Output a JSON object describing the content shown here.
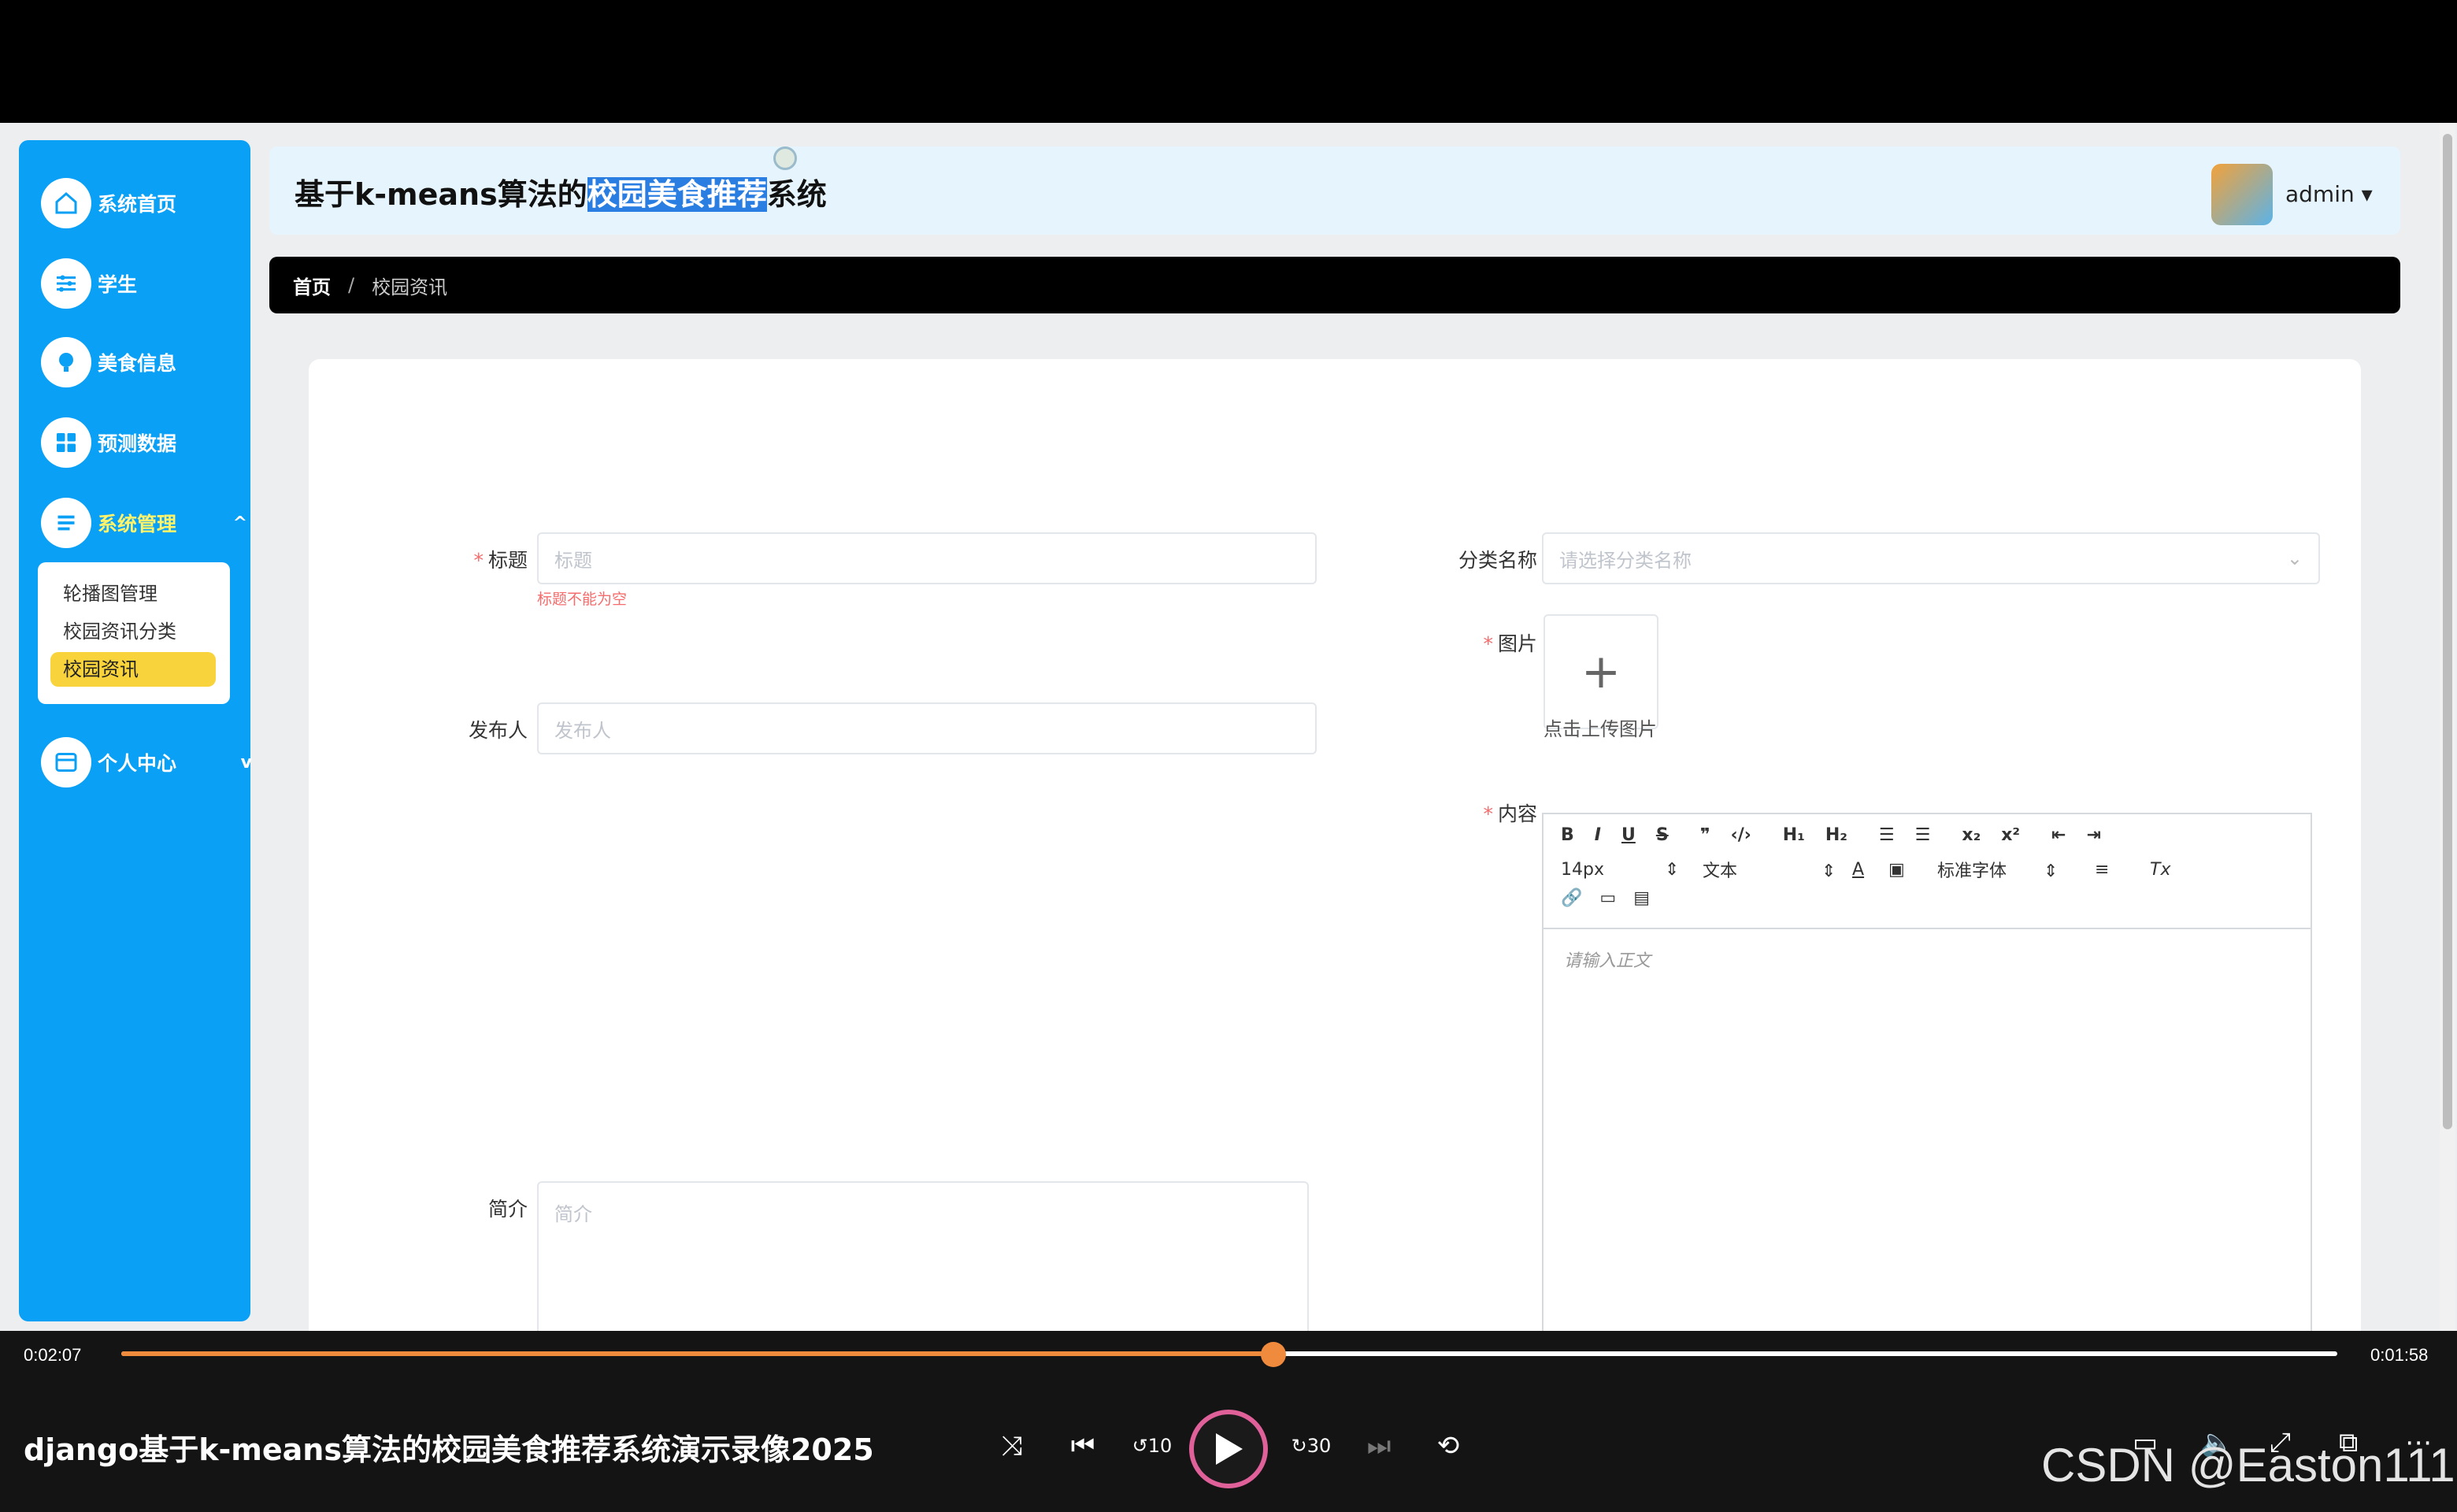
{
  "sidebar": {
    "items": [
      {
        "label": "系统首页",
        "icon": "home-icon"
      },
      {
        "label": "学生",
        "icon": "sliders-icon"
      },
      {
        "label": "美食信息",
        "icon": "bulb-icon"
      },
      {
        "label": "预测数据",
        "icon": "grid-icon"
      },
      {
        "label": "系统管理",
        "icon": "menu-icon"
      },
      {
        "label": "个人中心",
        "icon": "card-icon"
      }
    ],
    "submenu": [
      "轮播图管理",
      "校园资讯分类",
      "校园资讯"
    ],
    "accent": "#0aa0f5",
    "active_color": "#fff36b"
  },
  "header": {
    "title_pre": "基于k-means算法的",
    "title_highlight": "校园美食推荐",
    "title_post": "系统",
    "user": "admin ▾"
  },
  "breadcrumb": {
    "home": "首页",
    "sep": "/",
    "current": "校园资讯"
  },
  "form": {
    "title_label": "标题",
    "title_placeholder": "标题",
    "title_error": "标题不能为空",
    "category_label": "分类名称",
    "category_placeholder": "请选择分类名称",
    "image_label": "图片",
    "upload_tip": "点击上传图片",
    "publisher_label": "发布人",
    "publisher_placeholder": "发布人",
    "content_label": "内容",
    "content_placeholder": "请输入正文",
    "intro_label": "简介",
    "intro_placeholder": "简介",
    "toolbar": {
      "font_size": "14px",
      "block_type": "文本",
      "font_family": "标准字体"
    }
  },
  "player": {
    "elapsed": "0:02:07",
    "remaining": "0:01:58",
    "progress": 0.52,
    "title": "django基于k-means算法的校园美食推荐系统演示录像2025",
    "watermark": "CSDN @Easton111"
  }
}
